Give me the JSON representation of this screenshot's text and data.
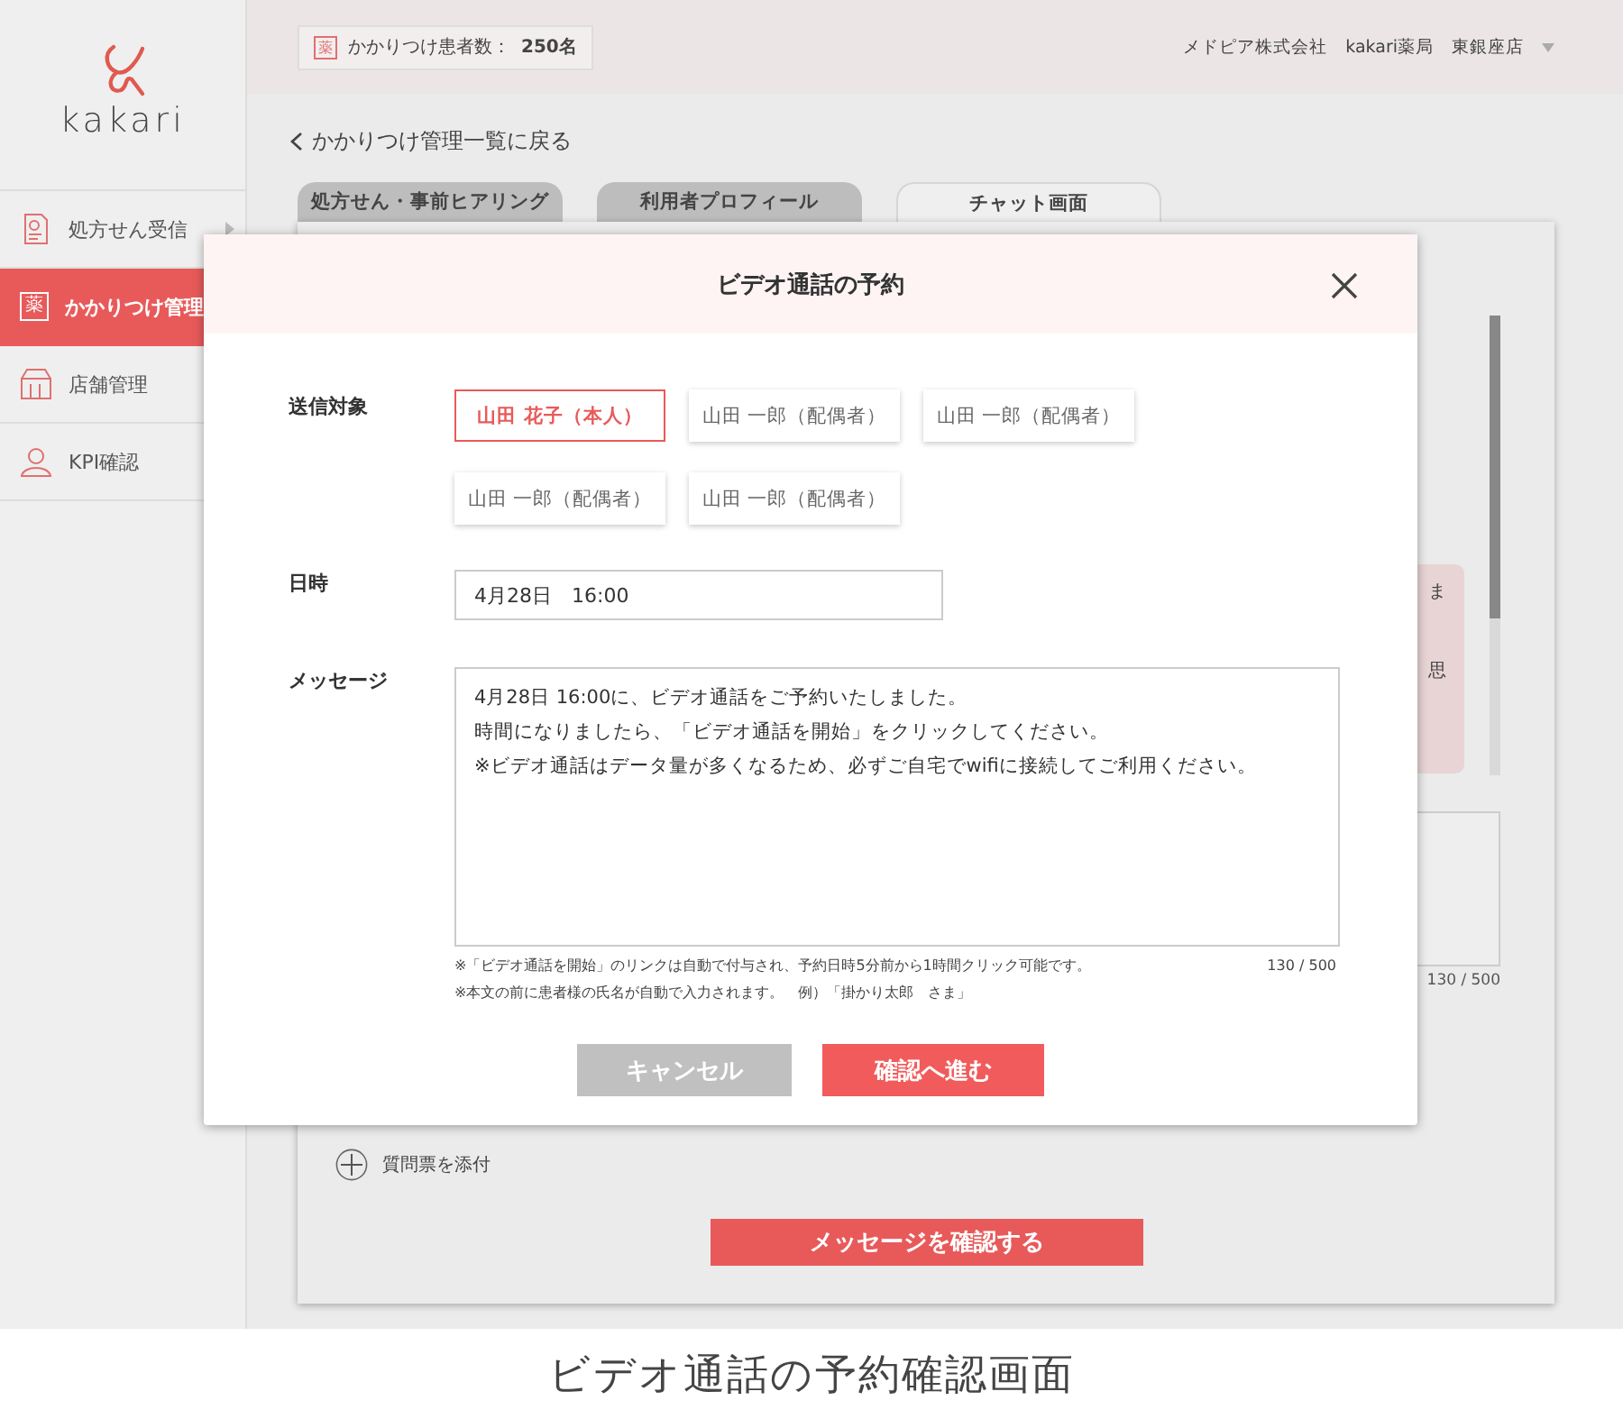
{
  "sidebar": {
    "logo": "kakari",
    "items": [
      {
        "label": "処方せん受信",
        "kind": "prescription",
        "selected": false
      },
      {
        "label": "かかりつけ管理",
        "kind": "badge",
        "badge": "薬",
        "selected": true
      },
      {
        "label": "店舗管理",
        "kind": "store",
        "selected": false
      },
      {
        "label": "KPI確認",
        "kind": "person",
        "selected": false
      }
    ]
  },
  "header": {
    "badge": "薬",
    "patient_count_label": "かかりつけ患者数：",
    "patient_count": "250名",
    "company": "メドピア株式会社",
    "pharmacy": "kakari薬局",
    "store": "東銀座店"
  },
  "back_link": "かかりつけ管理一覧に戻る",
  "tabs": [
    {
      "label": "処方せん・事前ヒアリング",
      "selected": false
    },
    {
      "label": "利用者プロフィール",
      "selected": false
    },
    {
      "label": "チャット画面",
      "selected": true
    }
  ],
  "chat": {
    "bubble_texts": [
      "ま",
      "思"
    ],
    "reply_counter": "130 / 500",
    "attach_label": "質問票を添付",
    "confirm_button": "メッセージを確認する"
  },
  "modal": {
    "title": "ビデオ通話の予約",
    "recipients_label": "送信対象",
    "recipients": [
      {
        "name": "山田 花子（本人）",
        "selected": true
      },
      {
        "name": "山田 一郎（配偶者）",
        "selected": false
      },
      {
        "name": "山田 一郎（配偶者）",
        "selected": false
      },
      {
        "name": "山田 一郎（配偶者）",
        "selected": false
      },
      {
        "name": "山田 一郎（配偶者）",
        "selected": false
      }
    ],
    "datetime_label": "日時",
    "datetime": "4月28日　16:00",
    "message_label": "メッセージ",
    "message_lines": [
      "4月28日 16:00に、ビデオ通話をご予約いたしました。",
      "時間になりましたら、「ビデオ通話を開始」をクリックしてください。",
      "※ビデオ通話はデータ量が多くなるため、必ずご自宅でwifiに接続してご利用ください。"
    ],
    "notes": [
      "※「ビデオ通話を開始」のリンクは自動で付与され、予約日時5分前から1時間クリック可能です。",
      "※本文の前に患者様の氏名が自動で入力されます。　例）「掛かり太郎　さま」"
    ],
    "counter": "130 / 500",
    "cancel": "キャンセル",
    "confirm": "確認へ進む"
  },
  "caption": "ビデオ通話の予約確認画面"
}
